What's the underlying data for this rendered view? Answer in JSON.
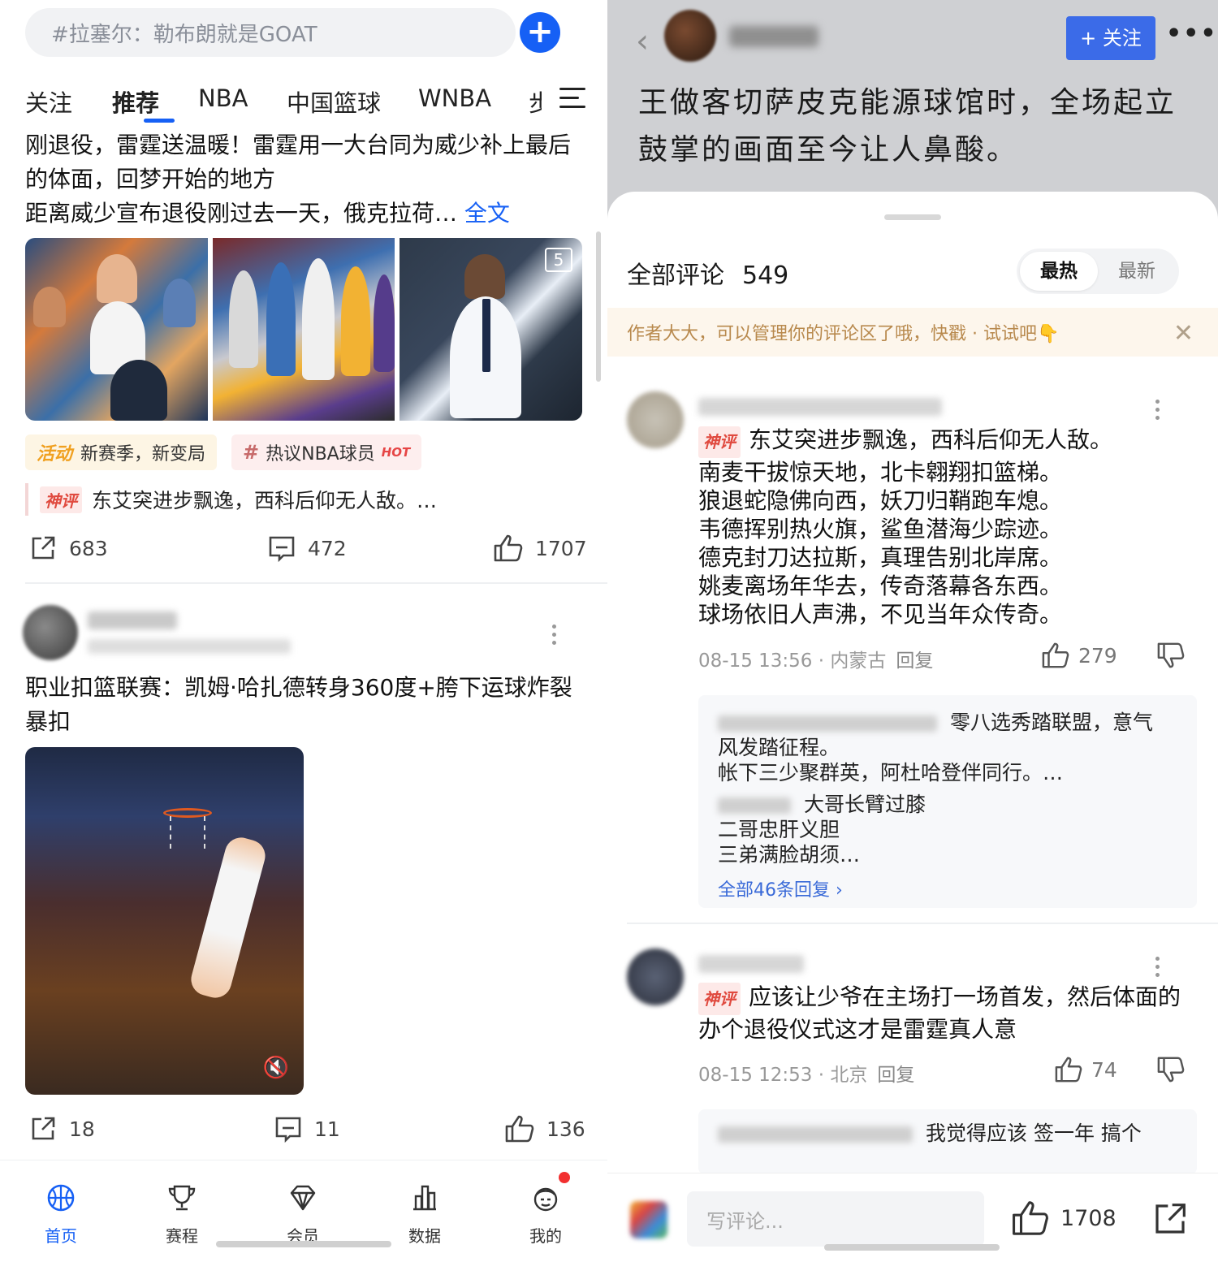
{
  "feed": {
    "search_placeholder": "#拉塞尔：勒布朗就是GOAT",
    "tabs": [
      "关注",
      "推荐",
      "NBA",
      "中国篮球",
      "WNBA",
      "步"
    ],
    "active_tab": "推荐",
    "post1": {
      "title": "刚退役，雷霆送温暖！雷霆用一大台同为威少补上最后的体面，回梦开始的地方",
      "summary": "距离威少宣布退役刚过去一天，俄克拉荷…",
      "more": "全文",
      "image_count": "5",
      "chip_activity_tag": "活动",
      "chip_activity_text": "新赛季，新变局",
      "chip_topic_hash": "#",
      "chip_topic_text": "热议NBA球员",
      "chip_topic_hot": "HOT",
      "shenping_badge": "神评",
      "shenping_text": "东艾突进步飘逸，西科后仰无人敌。…",
      "shares": "683",
      "comments": "472",
      "likes": "1707"
    },
    "post2": {
      "title": "职业扣篮联赛：凯姆·哈扎德转身360度+胯下运球炸裂暴扣",
      "shares": "18",
      "comments": "11",
      "likes": "136"
    },
    "bottom_nav": [
      {
        "label": "首页",
        "icon": "basketball-icon",
        "active": true
      },
      {
        "label": "赛程",
        "icon": "trophy-icon",
        "active": false
      },
      {
        "label": "会员",
        "icon": "diamond-icon",
        "active": false
      },
      {
        "label": "数据",
        "icon": "bar-chart-icon",
        "active": false
      },
      {
        "label": "我的",
        "icon": "profile-icon",
        "active": false
      }
    ]
  },
  "detail": {
    "follow_label": "+ 关注",
    "title": "王做客切萨皮克能源球馆时，全场起立鼓掌的画面至今让人鼻酸。",
    "comments_header": "全部评论",
    "comments_total": "549",
    "sort_hot": "最热",
    "sort_new": "最新",
    "notice": "作者大大，可以管理你的评论区了哦，快戳 · 试试吧👇",
    "comment1": {
      "badge": "神评",
      "lines": [
        "东艾突进步飘逸，西科后仰无人敌。",
        "南麦干拔惊天地，北卡翱翔扣篮梯。",
        "狼退蛇隐佛向西，妖刀归鞘跑车熄。",
        "韦德挥别热火旗，鲨鱼潜海少踪迹。",
        "德克封刀达拉斯，真理告别北岸席。",
        "姚麦离场年华去，传奇落幕各东西。",
        "球场依旧人声沸，不见当年众传奇。"
      ],
      "time": "08-15 13:56 · 内蒙古",
      "reply": "回复",
      "likes": "279",
      "reply_block": {
        "r1_line1": "零八选秀踏联盟，意气",
        "r1_line2": "风发踏征程。",
        "r1_line3": "帐下三少聚群英，阿杜哈登伴同行。…",
        "r2_line1": "大哥长臂过膝",
        "r2_line2": "二哥忠肝义胆",
        "r2_line3": "三弟满脸胡须…",
        "all": "全部46条回复 ›"
      }
    },
    "comment2": {
      "badge": "神评",
      "text": "应该让少爷在主场打一场首发，然后体面的办个退役仪式这才是雷霆真人意",
      "time": "08-15 12:53 · 北京",
      "reply": "回复",
      "likes": "74",
      "reply_preview": "我觉得应该 签一年  搞个"
    },
    "input_placeholder": "写评论...",
    "bottom_likes": "1708"
  }
}
